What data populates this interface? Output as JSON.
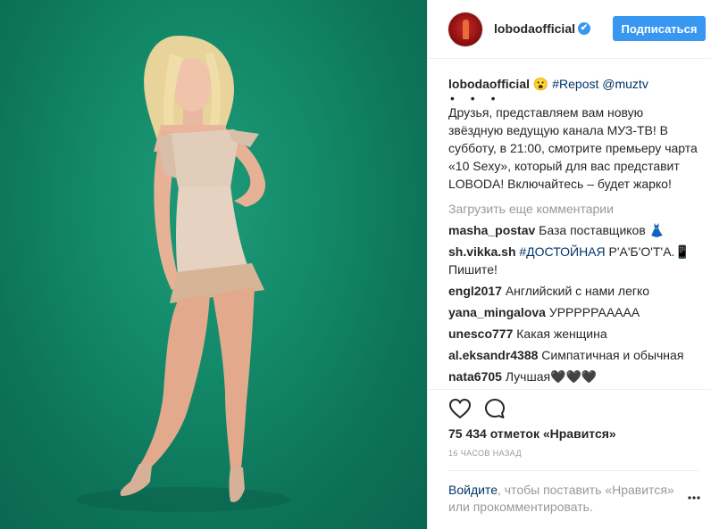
{
  "post": {
    "image_alt": "Photo of a woman in a beige dress on a green background"
  },
  "header": {
    "username": "lobodaofficial",
    "verified_badge": "✔",
    "follow_label": "Подписаться"
  },
  "caption": {
    "username": "lobodaofficial",
    "emoji": "😮",
    "hashtag": "#Repost",
    "mention": "@muztv",
    "dots": "• • •",
    "text": "Друзья, представляем вам новую звёздную ведущую канала МУЗ-ТВ! В субботу, в 21:00, смотрите премьеру чарта «10 Sexy», который для вас представит LOBODA! Включайтесь – будет жарко!"
  },
  "load_more_label": "Загрузить еще комментарии",
  "comments": [
    {
      "user": "masha_postav",
      "text": "База поставщиков 👗"
    },
    {
      "user": "sh.vikka.sh",
      "tag": "#ДОСТОЙНАЯ",
      "text": "Р'А'Б'О'Т'А.📱 Пишите!"
    },
    {
      "user": "engl2017",
      "text": "Английский с нами легко"
    },
    {
      "user": "yana_mingalova",
      "text": "УРРРРРААААА"
    },
    {
      "user": "unesco777",
      "text": "Какая женщина"
    },
    {
      "user": "al.eksandr4388",
      "text": "Симпатичная и обычная"
    },
    {
      "user": "nata6705",
      "text": "Лучшая🖤🖤🖤"
    }
  ],
  "actions": {
    "likes": "75 434 отметок «Нравится»",
    "time": "16 ЧАСОВ НАЗАД"
  },
  "login": {
    "link": "Войдите",
    "text": ", чтобы поставить «Нравится» или прокомментировать."
  },
  "colors": {
    "accent": "#3897f0",
    "link": "#003569",
    "background_green": "#138a69"
  }
}
